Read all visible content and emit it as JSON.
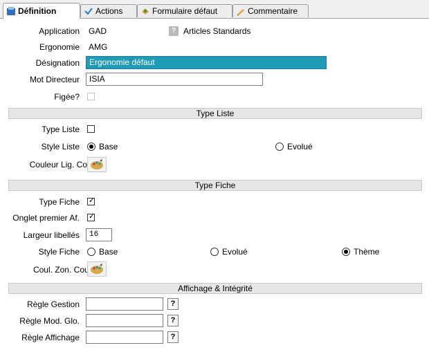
{
  "tabs": [
    {
      "label": "Définition",
      "icon": "definition-icon",
      "active": true
    },
    {
      "label": "Actions",
      "icon": "check-icon",
      "active": false
    },
    {
      "label": "Formulaire défaut",
      "icon": "form-icon",
      "active": false
    },
    {
      "label": "Commentaire",
      "icon": "comment-icon",
      "active": false
    }
  ],
  "fields": {
    "application_label": "Application",
    "application_value": "GAD",
    "articles_label": "Articles Standards",
    "ergonomie_label": "Ergonomie",
    "ergonomie_value": "AMG",
    "designation_label": "Désignation",
    "designation_value": "Ergonomie défaut",
    "mot_directeur_label": "Mot Directeur",
    "mot_directeur_value": "ISIA",
    "figee_label": "Figée?"
  },
  "sections": {
    "type_liste": "Type Liste",
    "type_fiche": "Type Fiche",
    "affichage": "Affichage & Intégrité"
  },
  "liste": {
    "type_label": "Type Liste",
    "style_label": "Style Liste",
    "style_options": [
      "Base",
      "Evolué"
    ],
    "style_selected": "Base",
    "couleur_label": "Couleur Lig. Cou."
  },
  "fiche": {
    "type_label": "Type Fiche",
    "onglet_label": "Onglet premier Af.",
    "largeur_label": "Largeur libellés",
    "largeur_value": "16",
    "style_label": "Style Fiche",
    "style_options": [
      "Base",
      "Evolué",
      "Thème"
    ],
    "style_selected": "Thème",
    "couleur_label": "Coul. Zon. Cou."
  },
  "affichage": {
    "regle_gestion_label": "Règle Gestion",
    "regle_mod_label": "Règle Mod. Glo.",
    "regle_affichage_label": "Règle Affichage",
    "help_label": "?"
  },
  "colors": {
    "selection": "#1f9bb5",
    "section_bg": "#e6e6e6",
    "active_tab_bg": "#ffffff"
  }
}
